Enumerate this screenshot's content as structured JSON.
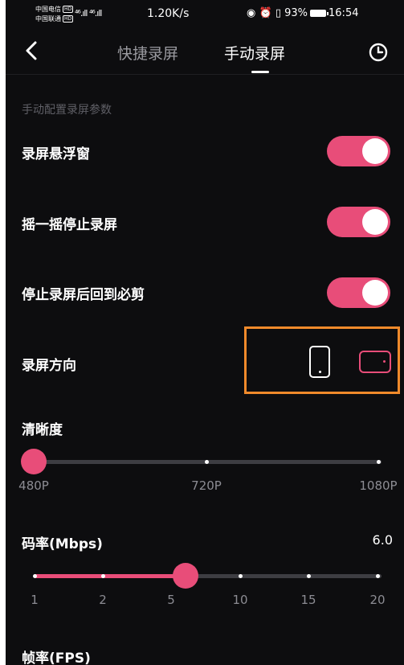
{
  "status_bar": {
    "carrier1": "中国电信",
    "carrier2": "中国联通",
    "hd": "HD",
    "signal": "⁴⁶.ıll ⁴⁶.ıll",
    "speed": "1.20K/s",
    "battery": "93%",
    "time": "16:54"
  },
  "header": {
    "tabs": [
      {
        "label": "快捷录屏",
        "active": false
      },
      {
        "label": "手动录屏",
        "active": true
      }
    ]
  },
  "section": {
    "label": "手动配置录屏参数"
  },
  "settings": {
    "floating_window": {
      "label": "录屏悬浮窗",
      "on": true
    },
    "shake_stop": {
      "label": "摇一摇停止录屏",
      "on": true
    },
    "return_after_stop": {
      "label": "停止录屏后回到必剪",
      "on": true
    },
    "orientation": {
      "label": "录屏方向",
      "options": [
        "portrait",
        "landscape"
      ],
      "selected": "landscape"
    }
  },
  "resolution": {
    "label": "清晰度",
    "options": [
      "480P",
      "720P",
      "1080P"
    ],
    "selected": "480P"
  },
  "bitrate": {
    "label": "码率(Mbps)",
    "value": "6.0",
    "ticks": [
      "1",
      "2",
      "5",
      "10",
      "15",
      "20"
    ]
  },
  "framerate": {
    "label": "帧率(FPS)"
  },
  "colors": {
    "accent": "#e84d79",
    "highlight_box": "#f08a2b",
    "background": "#0d0d0f"
  }
}
